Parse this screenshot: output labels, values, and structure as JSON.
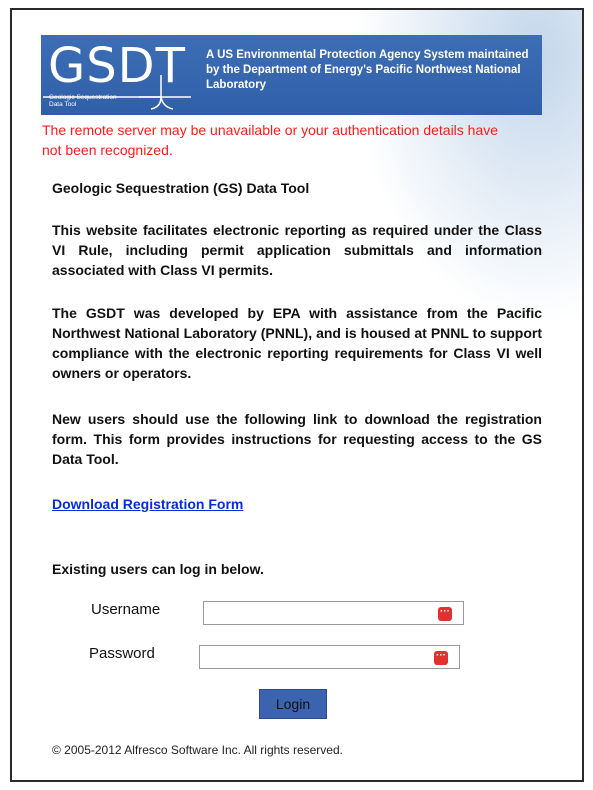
{
  "banner": {
    "logo_text": "GSDT",
    "logo_subtitle": "Geologic Sequestration Data Tool",
    "description": "A US Environmental Protection Agency System maintained by the Department of Energy's Pacific Northwest National Laboratory",
    "background_color": "#2f5fa8"
  },
  "error": {
    "message": "The remote server may be unavailable or your authentication details have not been recognized.",
    "color": "#ff1a1a"
  },
  "content": {
    "heading": "Geologic Sequestration (GS) Data Tool",
    "paragraph1": "This website facilitates electronic reporting as required under the Class VI Rule, including permit application submittals and information associated with Class VI permits.",
    "paragraph2": "The GSDT was developed by EPA with assistance from the Pacific Northwest National Laboratory (PNNL), and is housed at PNNL to support compliance with the electronic reporting requirements for Class VI well owners or operators.",
    "paragraph3": "New users should use the following link to download the registration form. This form provides instructions for requesting access to the GS Data Tool.",
    "download_link": "Download Registration Form"
  },
  "login": {
    "prompt": "Existing users can log in below.",
    "username_label": "Username",
    "username_value": "",
    "password_label": "Password",
    "password_value": "",
    "password_manager_icon": "password-manager-icon",
    "button_label": "Login"
  },
  "footer": {
    "copyright": "© 2005-2012 Alfresco Software Inc. All rights reserved."
  }
}
